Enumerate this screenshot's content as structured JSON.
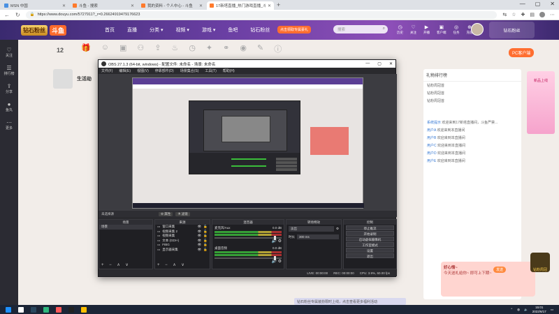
{
  "browser": {
    "tabs": [
      {
        "label": "MSN 中国",
        "color": "#4a90e2",
        "active": false
      },
      {
        "label": "斗鱼 - 搜索",
        "color": "#ff7a2c",
        "active": false
      },
      {
        "label": "我的资料 - 个人中心 - 斗鱼",
        "color": "#ff7a2c",
        "active": false
      },
      {
        "label": "17新塔直播_热门游戏直播_斗鱼直...",
        "color": "#ff7a2c",
        "active": true
      }
    ],
    "new_tab": "+",
    "window_controls": [
      "—",
      "▢",
      "✕"
    ],
    "url": "https://www.douyu.com/5727911?_r=0.26624919479176623",
    "nav": {
      "back": "←",
      "reload": "↻"
    }
  },
  "douyu_header": {
    "logo_badge": "钻石粉丝",
    "logo_text": "斗鱼",
    "nav": [
      "首页",
      "直播",
      "分类 ▾",
      "视频 ▾",
      "游戏 ▾",
      "鱼吧",
      "钻石粉丝"
    ],
    "promo_tag": "点击领取专属豪礼",
    "search_placeholder": "搜索",
    "search_icon": "search-icon",
    "icons": [
      {
        "label": "历史",
        "icon": "history-icon",
        "glyph": "◷"
      },
      {
        "label": "关注",
        "icon": "follow-icon",
        "glyph": "♡"
      },
      {
        "label": "开播",
        "icon": "broadcast-icon",
        "glyph": "▶"
      },
      {
        "label": "客户端",
        "icon": "client-icon",
        "glyph": "▣"
      },
      {
        "label": "任务",
        "icon": "task-icon",
        "glyph": "◎"
      },
      {
        "label": "充值",
        "icon": "recharge-icon",
        "glyph": "⊕"
      }
    ],
    "right_badge": "钻石粉丝"
  },
  "left_sidebar": [
    {
      "label": "关注",
      "icon": "heart-icon",
      "glyph": "♡"
    },
    {
      "label": "排行榜",
      "icon": "rank-icon",
      "glyph": "☰"
    },
    {
      "label": "分享",
      "icon": "share-icon",
      "glyph": "⇪"
    },
    {
      "label": "鱼丸",
      "icon": "fishball-icon",
      "glyph": "●"
    },
    {
      "label": "更多",
      "icon": "more-icon",
      "glyph": "⋯"
    }
  ],
  "page": {
    "number": "12",
    "streamer_name": "生活劫",
    "pc_btn": "PC客户端",
    "rank_title": "礼物排行榜",
    "rank_entries": [
      "钻粉周冠首",
      "钻粉周冠首",
      "钻粉周冠首"
    ],
    "chat": [
      {
        "name": "系统提示",
        "text": "欢迎来到17新塔直播间，斗鱼严禁..."
      },
      {
        "name": "用户A",
        "text": "欢迎来到本直播间"
      },
      {
        "name": "用户B",
        "text": "欢迎来到本直播间"
      },
      {
        "name": "用户C",
        "text": "欢迎来到本直播间"
      },
      {
        "name": "用户D",
        "text": "欢迎来到本直播间"
      },
      {
        "name": "用户E",
        "text": "欢迎来到本直播间"
      }
    ],
    "promo_title": "好心情~",
    "promo_text": "今天送礼给你~ 即可上下期~",
    "side_ad": "新品上线",
    "chat_send": "发送",
    "king_label": "钻粉周冠",
    "bottom_tag": "钻石粉丝专属装扮限时上线，点击查看更多福利活动"
  },
  "obs": {
    "title": "OBS 27.1.3 (64-bit, windows) - 配置文件: 未命名 - 场景: 未命名",
    "window_controls": [
      "—",
      "▢",
      "✕"
    ],
    "menu": [
      "文件(F)",
      "编辑(E)",
      "视图(V)",
      "停靠部件(D)",
      "场景集合(S)",
      "工具(T)",
      "帮助(H)"
    ],
    "source_bar": {
      "label": "未选择源",
      "props": "⚙ 属性",
      "filters": "⚗ 滤镜"
    },
    "scenes": {
      "header": "场景",
      "items": [
        "场景"
      ]
    },
    "sources": {
      "header": "来源",
      "items": [
        "窗口采集",
        "视频采集 2",
        "视频采集",
        "文本 (GDI+)",
        "FIBG",
        "显示器采集"
      ]
    },
    "mixer": {
      "header": "混音器",
      "tracks": [
        {
          "name": "麦克风/Aux",
          "db": "0.0 dB"
        },
        {
          "name": "桌面音频",
          "db": "0.0 dB"
        }
      ]
    },
    "transitions": {
      "header": "转场特效",
      "type": "淡出",
      "duration_label": "时长",
      "duration": "300 ms"
    },
    "controls": {
      "header": "控制",
      "buttons": [
        "停止推流",
        "开始录制",
        "启动虚拟摄像机",
        "工作室模式",
        "设置",
        "退出"
      ]
    },
    "status": {
      "live": "LIVE: 00:00:00",
      "rec": "REC: 00:00:00",
      "cpu": "CPU: 3.9%, 60.00 fps"
    },
    "footer_icons": "+ − ∧ ∨"
  },
  "taskbar": {
    "apps": [
      {
        "name": "windows-icon",
        "color": "#1e90ff"
      },
      {
        "name": "search-icon",
        "color": "#ffffff"
      },
      {
        "name": "steam-icon",
        "color": "#2a475e"
      },
      {
        "name": "edge-icon",
        "color": "#2fb67c"
      },
      {
        "name": "game-icon",
        "color": "#ff5a5a"
      },
      {
        "name": "obs-icon",
        "color": "#222222"
      },
      {
        "name": "chrome-icon",
        "color": "#ffbf00"
      }
    ],
    "time": "15:01",
    "date": "2022/6/17"
  }
}
